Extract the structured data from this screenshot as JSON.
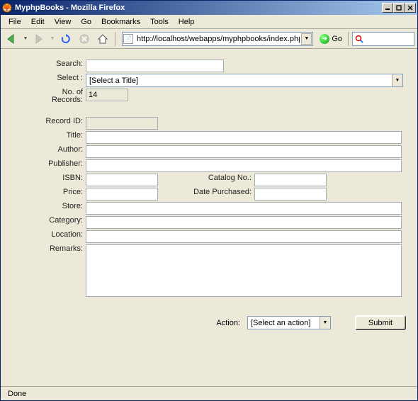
{
  "window": {
    "title": "MyphpBooks - Mozilla Firefox"
  },
  "menu": {
    "file": "File",
    "edit": "Edit",
    "view": "View",
    "go": "Go",
    "bookmarks": "Bookmarks",
    "tools": "Tools",
    "help": "Help"
  },
  "toolbar": {
    "url": "http://localhost/webapps/myphpbooks/index.php",
    "go_label": "Go"
  },
  "form": {
    "labels": {
      "search": "Search:",
      "select": "Select :",
      "no_of_records": "No. of Records:",
      "record_id": "Record ID:",
      "title": "Title:",
      "author": "Author:",
      "publisher": "Publisher:",
      "isbn": "ISBN:",
      "catalog_no": "Catalog No.:",
      "price": "Price:",
      "date_purchased": "Date Purchased:",
      "store": "Store:",
      "category": "Category:",
      "location": "Location:",
      "remarks": "Remarks:",
      "action": "Action:"
    },
    "values": {
      "search": "",
      "select_placeholder": "[Select a Title]",
      "no_of_records": "14",
      "record_id": "",
      "title": "",
      "author": "",
      "publisher": "",
      "isbn": "",
      "catalog_no": "",
      "price": "",
      "date_purchased": "",
      "store": "",
      "category": "",
      "location": "",
      "remarks": "",
      "action_placeholder": "[Select an action]"
    },
    "submit_label": "Submit"
  },
  "status": {
    "text": "Done"
  }
}
